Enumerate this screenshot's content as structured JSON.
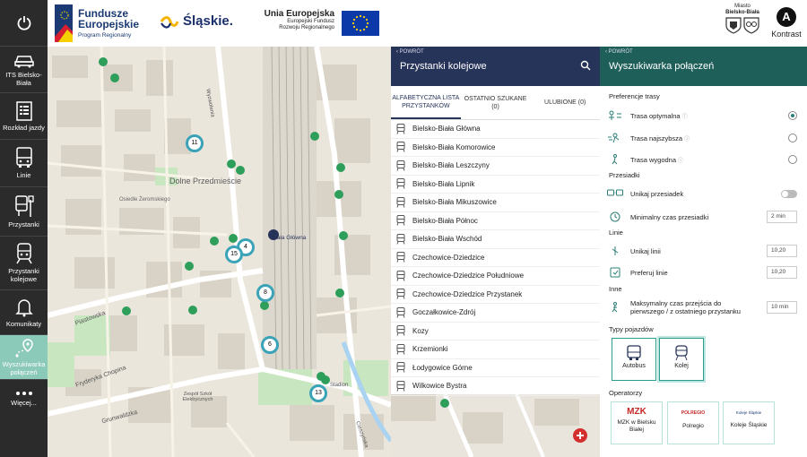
{
  "sidebar": {
    "items": [
      {
        "label": "ITS Bielsko-Biała",
        "icon": "car-icon"
      },
      {
        "label": "Rozkład jazdy",
        "icon": "timetable-icon"
      },
      {
        "label": "Linie",
        "icon": "bus-front-icon"
      },
      {
        "label": "Przystanki",
        "icon": "bus-stop-icon"
      },
      {
        "label": "Przystanki kolejowe",
        "icon": "train-icon"
      },
      {
        "label": "Komunikaty",
        "icon": "bell-icon"
      },
      {
        "label": "Wyszukiwarka połączeń",
        "icon": "route-pin-icon"
      },
      {
        "label": "Więcej...",
        "icon": "more-dots-icon"
      }
    ]
  },
  "header": {
    "fe_line1": "Fundusze",
    "fe_line2": "Europejskie",
    "fe_line3": "Program Regionalny",
    "slaskie": "Śląskie.",
    "ue_line1": "Unia Europejska",
    "ue_line2": "Europejski Fundusz",
    "ue_line3": "Rozwoju Regionalnego",
    "bb_line1": "Miasto",
    "bb_line2": "Bielsko-Biała",
    "contrast_letter": "A",
    "contrast_label": "Kontrast"
  },
  "map": {
    "labels": [
      "Dolne Przedmieście",
      "Osiedle Żeromskiego",
      "Biała Główna",
      "Piastowska",
      "Fryderyka Chopina",
      "Grunwaldzka",
      "Cieszyńska",
      "Wyzwolenia",
      "Zespół Szkół Elektrycznych",
      "Stadion"
    ],
    "markers": [
      "11",
      "4",
      "15",
      "8",
      "6",
      "13"
    ]
  },
  "stops": {
    "back": "POWRÓT",
    "title": "Przystanki kolejowe",
    "tabs": [
      {
        "label": "ALFABETYCZNA LISTA PRZYSTANKÓW"
      },
      {
        "label": "OSTATNIO SZUKANE (0)"
      },
      {
        "label": "ULUBIONE (0)"
      }
    ],
    "list": [
      "Bielsko-Biała Główna",
      "Bielsko-Biała Komorowice",
      "Bielsko-Biała Leszczyny",
      "Bielsko-Biała Lipnik",
      "Bielsko-Biała Mikuszowice",
      "Bielsko-Biała Północ",
      "Bielsko-Biała Wschód",
      "Czechowice-Dziedzice",
      "Czechowice-Dziedzice Południowe",
      "Czechowice-Dziedzice Przystanek",
      "Goczałkowice-Zdrój",
      "Kozy",
      "Krzemionki",
      "Łodygowice Górne",
      "Wilkowice Bystra"
    ]
  },
  "finder": {
    "back": "POWRÓT",
    "title": "Wyszukiwarka połączeń",
    "pref_title": "Preferencje trasy",
    "route_options": [
      {
        "label": "Trasa optymalna",
        "selected": true
      },
      {
        "label": "Trasa najszybsza",
        "selected": false
      },
      {
        "label": "Trasa wygodna",
        "selected": false
      }
    ],
    "transfers_title": "Przesiadki",
    "avoid_transfers": "Unikaj przesiadek",
    "min_transfer_time": "Minimalny czas przesiadki",
    "min_transfer_value": "2 min",
    "lines_title": "Linie",
    "avoid_lines": "Unikaj linii",
    "avoid_lines_value": "10,20",
    "prefer_lines": "Preferuj linie",
    "prefer_lines_value": "10,20",
    "other_title": "Inne",
    "max_walk_label": "Maksymalny czas przejścia do pierwszego / z ostatniego przystanku",
    "max_walk_value": "10 min",
    "vehicle_title": "Typy pojazdów",
    "vehicles": [
      {
        "label": "Autobus",
        "selected": false
      },
      {
        "label": "Kolej",
        "selected": true
      }
    ],
    "operators_title": "Operatorzy",
    "operators": [
      {
        "label": "MZK w Bielsku Białej",
        "logo": "MZK"
      },
      {
        "label": "Polregio",
        "logo": "POLREGIO"
      },
      {
        "label": "Koleje Śląskie",
        "logo": "Koleje Śląskie"
      }
    ]
  },
  "colors": {
    "sidebar": "#2b2b2b",
    "sidebar_active": "#8bc9b8",
    "stops_header": "#27345a",
    "finder_header": "#1f5f5a",
    "accent": "#2a9d8f"
  }
}
